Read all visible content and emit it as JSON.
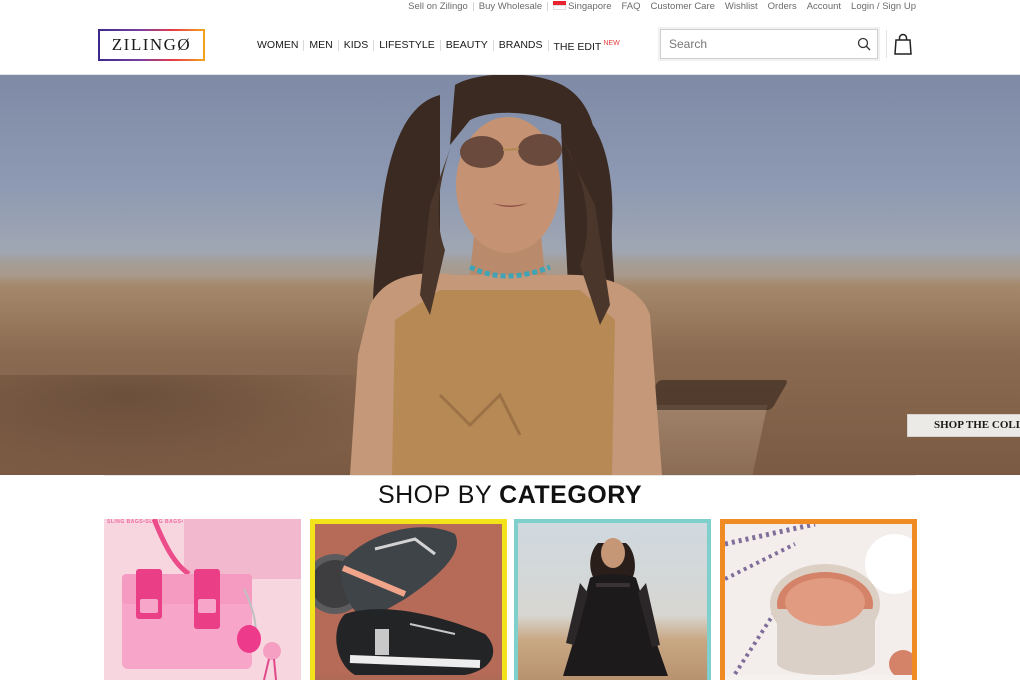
{
  "utility_links": [
    {
      "label": "Sell on Zilingo"
    },
    {
      "label": "Buy Wholesale"
    },
    {
      "label": "Singapore",
      "icon": "singapore-flag-icon"
    },
    {
      "label": "FAQ"
    },
    {
      "label": "Customer Care"
    },
    {
      "label": "Wishlist"
    },
    {
      "label": "Orders"
    },
    {
      "label": "Account"
    },
    {
      "label": "Login / Sign Up"
    }
  ],
  "header": {
    "logo_text": "ZILINGØ",
    "nav": [
      {
        "label": "WOMEN"
      },
      {
        "label": "MEN"
      },
      {
        "label": "KIDS"
      },
      {
        "label": "LIFESTYLE"
      },
      {
        "label": "BEAUTY"
      },
      {
        "label": "BRANDS"
      },
      {
        "label": "THE EDIT",
        "badge": "NEW"
      }
    ],
    "search_placeholder": "Search",
    "icons": [
      "search-icon",
      "shopping-bag-icon"
    ]
  },
  "hero": {
    "cta_label": "SHOP THE COLLECTION"
  },
  "section": {
    "title_light": "SHOP BY ",
    "title_bold": "CATEGORY"
  },
  "categories": [
    {
      "name": "sling-bags",
      "ribbon": "SLING BAGS•SLING BAGS•SLING BAGS•SLING BAGS",
      "border_color": "#f7d6e0"
    },
    {
      "name": "sneakers",
      "border_color": "#f3e31a"
    },
    {
      "name": "dresses",
      "border_color": "#7fd0cc"
    },
    {
      "name": "beauty",
      "border_color": "#f08a22"
    }
  ],
  "colors": {
    "badge_new": "#e4423f",
    "logo_gradient": [
      "#3d2a8c",
      "#7b3fa0",
      "#e73a4a",
      "#f3a21c"
    ]
  }
}
